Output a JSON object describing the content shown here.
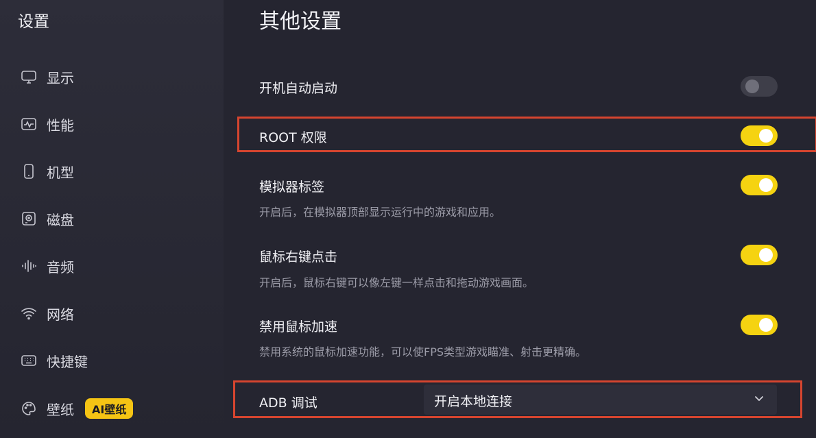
{
  "sidebar": {
    "title": "设置",
    "items": [
      {
        "label": "显示",
        "icon": "monitor-icon"
      },
      {
        "label": "性能",
        "icon": "performance-icon"
      },
      {
        "label": "机型",
        "icon": "phone-icon"
      },
      {
        "label": "磁盘",
        "icon": "disk-icon"
      },
      {
        "label": "音频",
        "icon": "audio-icon"
      },
      {
        "label": "网络",
        "icon": "wifi-icon"
      },
      {
        "label": "快捷键",
        "icon": "keyboard-icon"
      },
      {
        "label": "壁纸",
        "icon": "palette-icon",
        "badge": "AI壁纸"
      }
    ]
  },
  "main": {
    "title": "其他设置",
    "settings": [
      {
        "label": "开机自动启动",
        "enabled": false
      },
      {
        "label": "ROOT 权限",
        "enabled": true
      },
      {
        "label": "模拟器标签",
        "description": "开启后，在模拟器顶部显示运行中的游戏和应用。",
        "enabled": true
      },
      {
        "label": "鼠标右键点击",
        "description": "开启后，鼠标右键可以像左键一样点击和拖动游戏画面。",
        "enabled": true
      },
      {
        "label": "禁用鼠标加速",
        "description": "禁用系统的鼠标加速功能，可以使FPS类型游戏瞄准、射击更精确。",
        "enabled": true
      }
    ],
    "adb": {
      "label": "ADB 调试",
      "value": "开启本地连接"
    }
  },
  "colors": {
    "accent": "#f5d311",
    "highlight": "#d6452f",
    "background": "#252530",
    "badge": "#f5c414"
  }
}
